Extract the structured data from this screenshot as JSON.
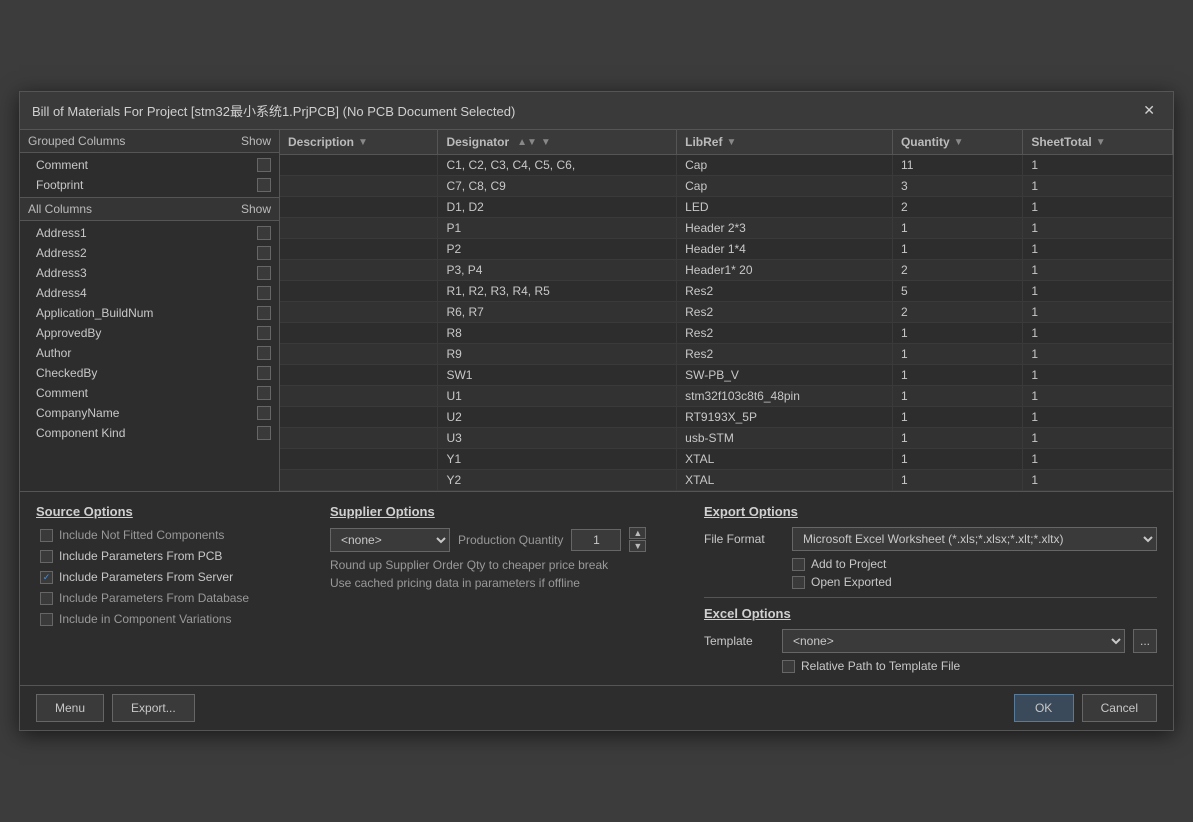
{
  "dialog": {
    "title": "Bill of Materials For Project [stm32最小系统1.PrjPCB] (No PCB Document Selected)",
    "close_btn": "✕"
  },
  "left_panel": {
    "grouped_header": "Grouped Columns",
    "grouped_show": "Show",
    "grouped_items": [
      {
        "label": "Comment",
        "checked": false
      },
      {
        "label": "Footprint",
        "checked": false
      }
    ],
    "all_columns_header": "All Columns",
    "all_columns_show": "Show",
    "all_columns_items": [
      {
        "label": "Address1",
        "checked": false
      },
      {
        "label": "Address2",
        "checked": false
      },
      {
        "label": "Address3",
        "checked": false
      },
      {
        "label": "Address4",
        "checked": false
      },
      {
        "label": "Application_BuildNum",
        "checked": false
      },
      {
        "label": "ApprovedBy",
        "checked": false
      },
      {
        "label": "Author",
        "checked": false
      },
      {
        "label": "CheckedBy",
        "checked": false
      },
      {
        "label": "Comment",
        "checked": false
      },
      {
        "label": "CompanyName",
        "checked": false
      },
      {
        "label": "Component Kind",
        "checked": false
      }
    ]
  },
  "table": {
    "columns": [
      {
        "label": "Description",
        "sort": "",
        "filter": true
      },
      {
        "label": "Designator",
        "sort": "▲▼",
        "filter": true
      },
      {
        "label": "LibRef",
        "sort": "",
        "filter": true
      },
      {
        "label": "Quantity",
        "sort": "",
        "filter": true
      },
      {
        "label": "SheetTotal",
        "sort": "",
        "filter": true
      }
    ],
    "rows": [
      {
        "description": "",
        "designator": "C1, C2, C3, C4, C5, C6,",
        "libref": "Cap",
        "quantity": "11",
        "sheettotal": "1"
      },
      {
        "description": "",
        "designator": "C7, C8, C9",
        "libref": "Cap",
        "quantity": "3",
        "sheettotal": "1"
      },
      {
        "description": "",
        "designator": "D1, D2",
        "libref": "LED",
        "quantity": "2",
        "sheettotal": "1"
      },
      {
        "description": "",
        "designator": "P1",
        "libref": "Header 2*3",
        "quantity": "1",
        "sheettotal": "1"
      },
      {
        "description": "",
        "designator": "P2",
        "libref": "Header 1*4",
        "quantity": "1",
        "sheettotal": "1"
      },
      {
        "description": "",
        "designator": "P3, P4",
        "libref": "Header1* 20",
        "quantity": "2",
        "sheettotal": "1"
      },
      {
        "description": "",
        "designator": "R1, R2, R3, R4, R5",
        "libref": "Res2",
        "quantity": "5",
        "sheettotal": "1"
      },
      {
        "description": "",
        "designator": "R6, R7",
        "libref": "Res2",
        "quantity": "2",
        "sheettotal": "1"
      },
      {
        "description": "",
        "designator": "R8",
        "libref": "Res2",
        "quantity": "1",
        "sheettotal": "1"
      },
      {
        "description": "",
        "designator": "R9",
        "libref": "Res2",
        "quantity": "1",
        "sheettotal": "1"
      },
      {
        "description": "",
        "designator": "SW1",
        "libref": "SW-PB_V",
        "quantity": "1",
        "sheettotal": "1"
      },
      {
        "description": "",
        "designator": "U1",
        "libref": "stm32f103c8t6_48pin",
        "quantity": "1",
        "sheettotal": "1"
      },
      {
        "description": "",
        "designator": "U2",
        "libref": "RT9193X_5P",
        "quantity": "1",
        "sheettotal": "1"
      },
      {
        "description": "",
        "designator": "U3",
        "libref": "usb-STM",
        "quantity": "1",
        "sheettotal": "1"
      },
      {
        "description": "",
        "designator": "Y1",
        "libref": "XTAL",
        "quantity": "1",
        "sheettotal": "1"
      },
      {
        "description": "",
        "designator": "Y2",
        "libref": "XTAL",
        "quantity": "1",
        "sheettotal": "1"
      }
    ]
  },
  "source_options": {
    "title": "Source Options",
    "items": [
      {
        "label": "Include Not Fitted Components",
        "enabled": false,
        "checked": false
      },
      {
        "label": "Include Parameters From PCB",
        "enabled": true,
        "checked": false
      },
      {
        "label": "Include Parameters From Server",
        "enabled": true,
        "checked": true
      },
      {
        "label": "Include Parameters From Database",
        "enabled": false,
        "checked": false
      },
      {
        "label": "Include in Component Variations",
        "enabled": false,
        "checked": false
      }
    ]
  },
  "supplier_options": {
    "title": "Supplier Options",
    "supplier_value": "<none>",
    "production_quantity_label": "Production Quantity",
    "production_quantity_value": "1",
    "round_up_label": "Round up Supplier Order Qty to cheaper price break",
    "cached_pricing_label": "Use cached pricing data in parameters if offline"
  },
  "export_options": {
    "title": "Export Options",
    "file_format_label": "File Format",
    "file_format_value": "Microsoft Excel Worksheet (*.xls;*.xlsx;*.xlt;*.xltx)",
    "add_to_project_label": "Add to Project",
    "add_to_project_checked": false,
    "open_exported_label": "Open Exported",
    "open_exported_checked": false
  },
  "excel_options": {
    "title": "Excel Options",
    "template_label": "Template",
    "template_value": "<none>",
    "relative_path_label": "Relative Path to Template File",
    "relative_path_checked": false,
    "dots_btn": "..."
  },
  "footer": {
    "menu_btn": "Menu",
    "export_btn": "Export...",
    "ok_btn": "OK",
    "cancel_btn": "Cancel"
  }
}
